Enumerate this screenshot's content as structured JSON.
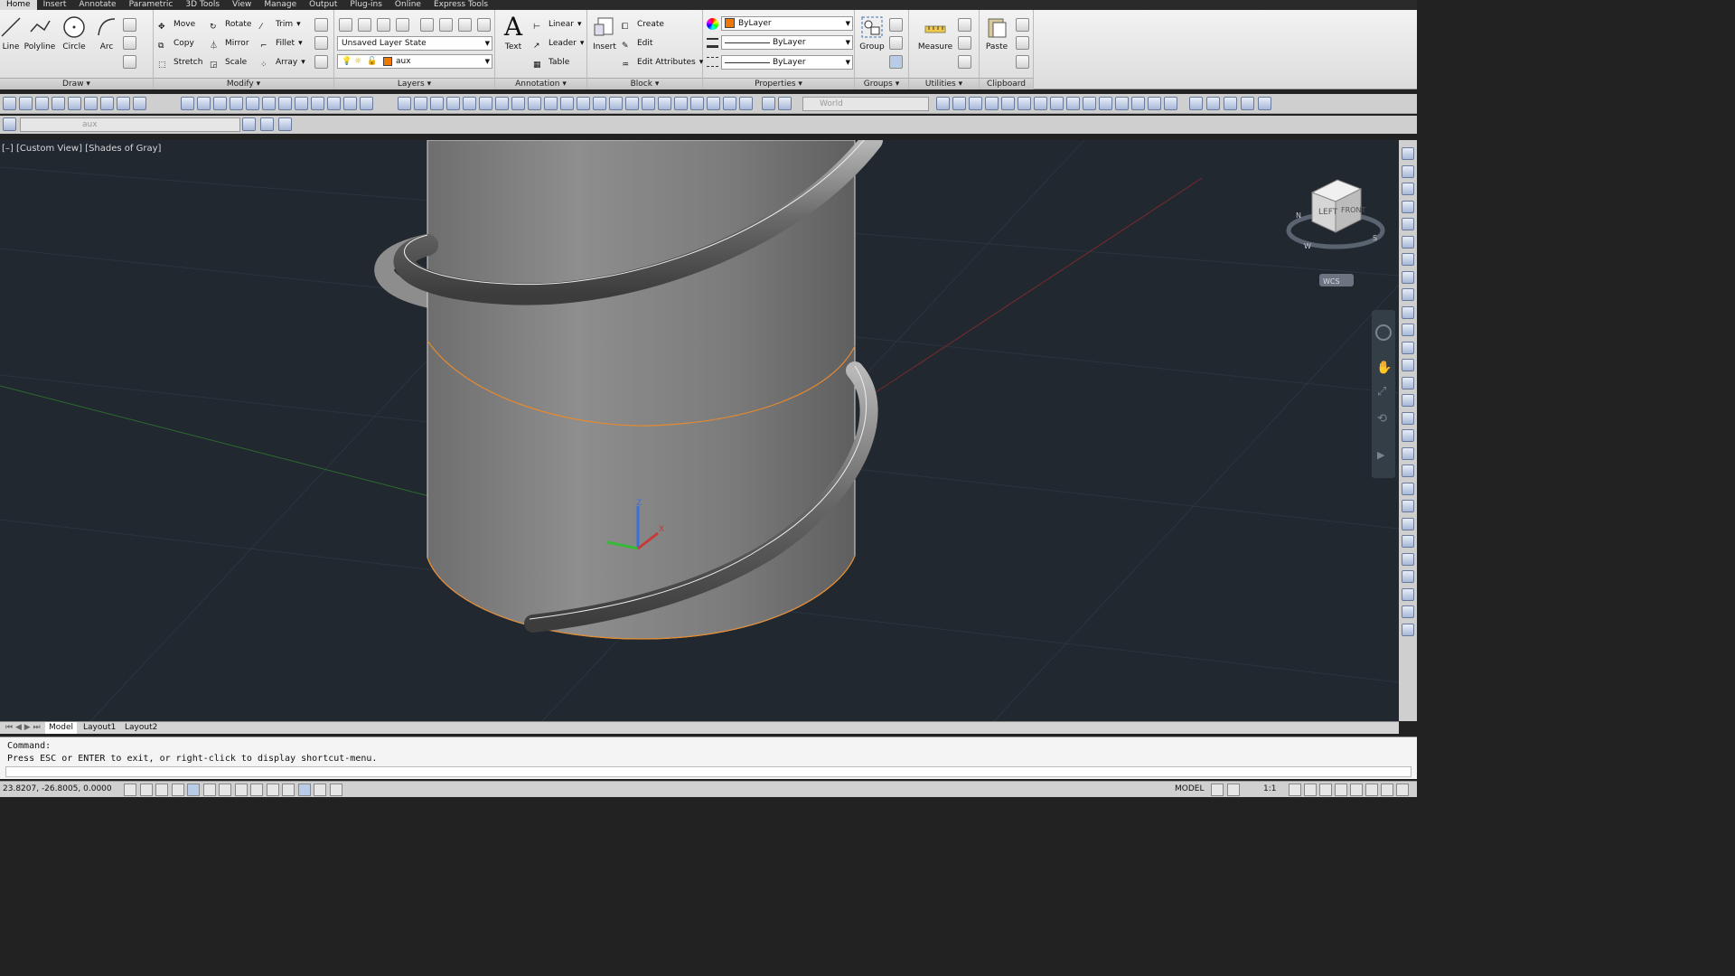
{
  "tabs": [
    "Home",
    "Insert",
    "Annotate",
    "Parametric",
    "3D Tools",
    "View",
    "Manage",
    "Output",
    "Plug-ins",
    "Online",
    "Express Tools"
  ],
  "ribbon": {
    "draw": {
      "title": "Draw",
      "line": "Line",
      "polyline": "Polyline",
      "circle": "Circle",
      "arc": "Arc"
    },
    "modify": {
      "title": "Modify",
      "move": "Move",
      "copy": "Copy",
      "stretch": "Stretch",
      "rotate": "Rotate",
      "mirror": "Mirror",
      "scale": "Scale",
      "trim": "Trim",
      "fillet": "Fillet",
      "array": "Array"
    },
    "layers": {
      "title": "Layers",
      "layer_state": "Unsaved Layer State",
      "current_layer": "aux"
    },
    "annotation": {
      "title": "Annotation",
      "text": "Text",
      "linear": "Linear",
      "leader": "Leader",
      "table": "Table"
    },
    "block": {
      "title": "Block",
      "insert": "Insert",
      "create": "Create",
      "edit": "Edit",
      "edit_attributes": "Edit Attributes"
    },
    "properties": {
      "title": "Properties",
      "color": "ByLayer",
      "linetype": "ByLayer",
      "lineweight": "ByLayer"
    },
    "groups": {
      "title": "Groups",
      "group": "Group"
    },
    "utilities": {
      "title": "Utilities",
      "measure": "Measure"
    },
    "clipboard": {
      "title": "Clipboard",
      "paste": "Paste"
    }
  },
  "toolbar": {
    "ucs_combo": "World",
    "layer_combo": "aux"
  },
  "viewport": {
    "label": "[–] [Custom View] [Shades of Gray]",
    "viewcube_face_left": "LEFT",
    "viewcube_face_front": "FRONT",
    "compass_n": "N",
    "compass_s": "S",
    "compass_w": "W",
    "wcs": "WCS"
  },
  "layout_tabs": [
    "Model",
    "Layout1",
    "Layout2"
  ],
  "command": {
    "line1": "Command:",
    "line2": "Press ESC or ENTER to exit, or right-click to display shortcut-menu."
  },
  "status": {
    "coordinates": "23.8207, -26.8005, 0.0000",
    "model": "MODEL",
    "annotation_scale": "1:1"
  },
  "colors": {
    "layer_color": "#f07800",
    "viewport_bg": "#212830",
    "highlight_edge": "#e68a2e"
  }
}
